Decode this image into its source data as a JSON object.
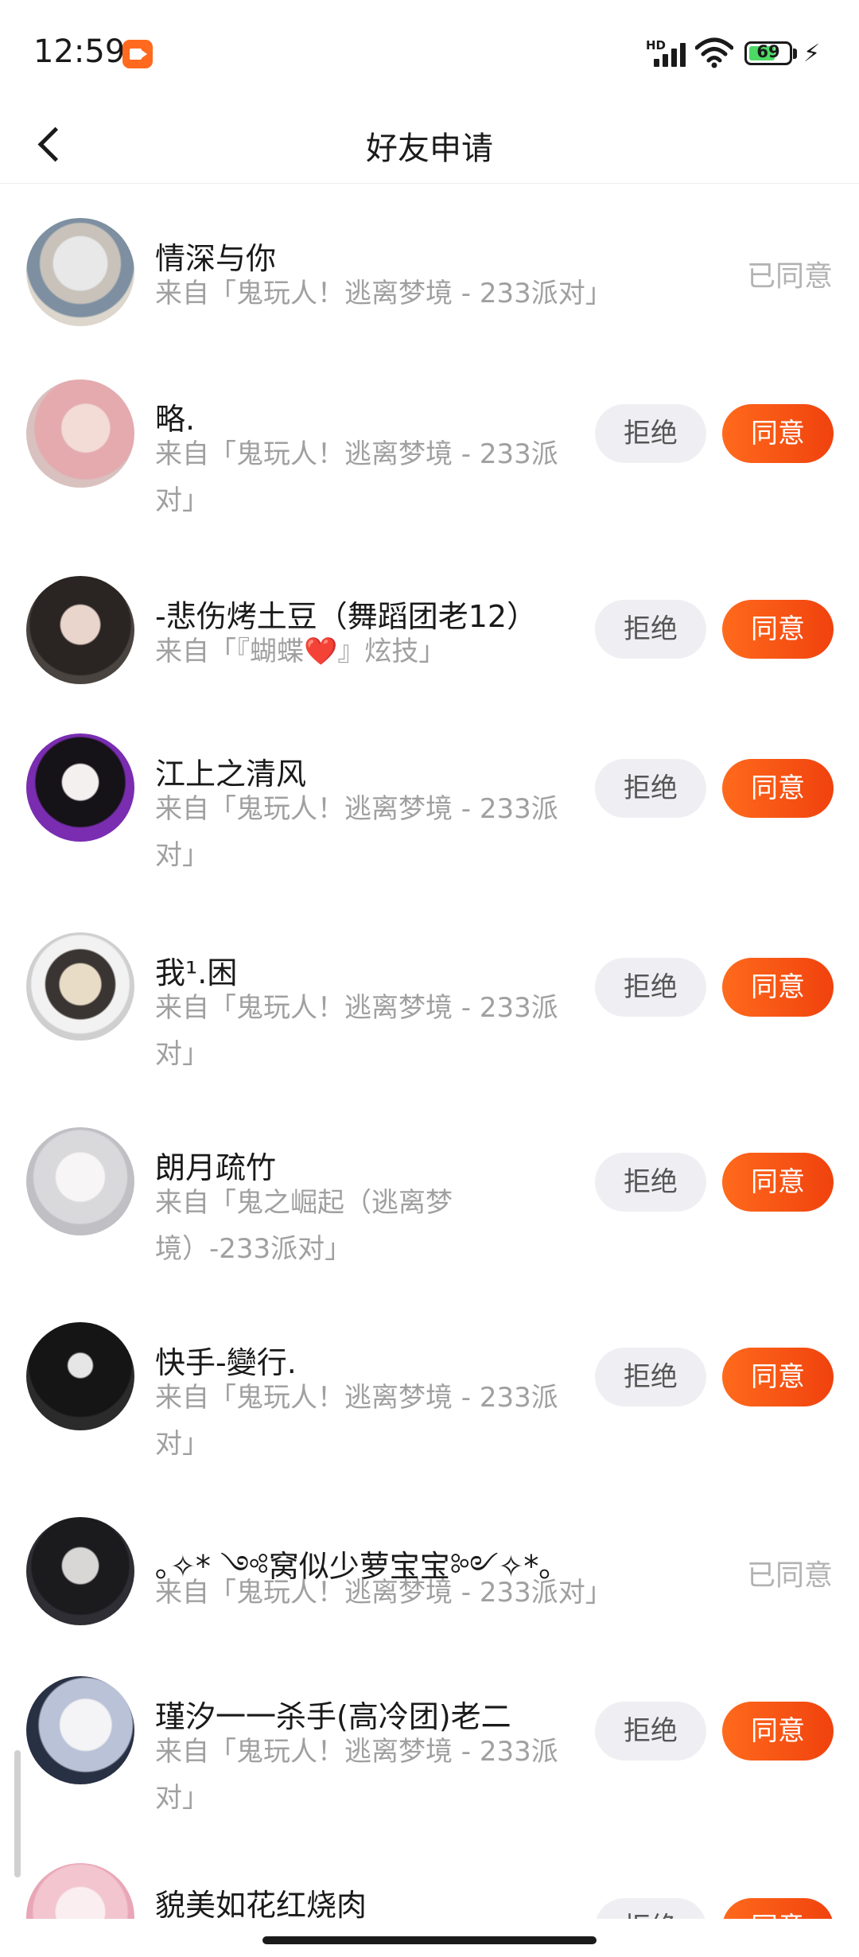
{
  "status_bar": {
    "time": "12:59",
    "network": "HD",
    "battery": "69"
  },
  "header": {
    "title": "好友申请"
  },
  "labels": {
    "reject": "拒绝",
    "accept": "同意"
  },
  "requests": [
    {
      "name": "情深与你",
      "source": "来自「鬼玩人！逃离梦境 - 233派对」",
      "status": "已同意"
    },
    {
      "name": "略.",
      "source": "来自「鬼玩人！逃离梦境 - 233派对」",
      "status": ""
    },
    {
      "name": "-悲伤烤土豆（舞蹈团老12）",
      "source": "来自「『蝴蝶❤️』炫技」",
      "status": ""
    },
    {
      "name": "江上之清风",
      "source": "来自「鬼玩人！逃离梦境 - 233派对」",
      "status": ""
    },
    {
      "name": "我¹.困",
      "source": "来自「鬼玩人！逃离梦境 - 233派对」",
      "status": ""
    },
    {
      "name": "朗月疏竹",
      "source": "来自「鬼之崛起（逃离梦境）-233派对」",
      "status": ""
    },
    {
      "name": "快手-變行.",
      "source": "来自「鬼玩人！逃离梦境 - 233派对」",
      "status": ""
    },
    {
      "name": "｡✧* ༺窝似少萝宝宝༻✧*｡",
      "source": "来自「鬼玩人！逃离梦境 - 233派对」",
      "status": "已同意"
    },
    {
      "name": "瑾汐一一杀手(高冷团)老二",
      "source": "来自「鬼玩人！逃离梦境 - 233派对」",
      "status": ""
    },
    {
      "name": "貌美如花红烧肉",
      "source": "",
      "status": ""
    }
  ],
  "colors": {
    "accent": "#f4511e",
    "reject_bg": "#efeff3",
    "muted": "#a0a0a0"
  }
}
